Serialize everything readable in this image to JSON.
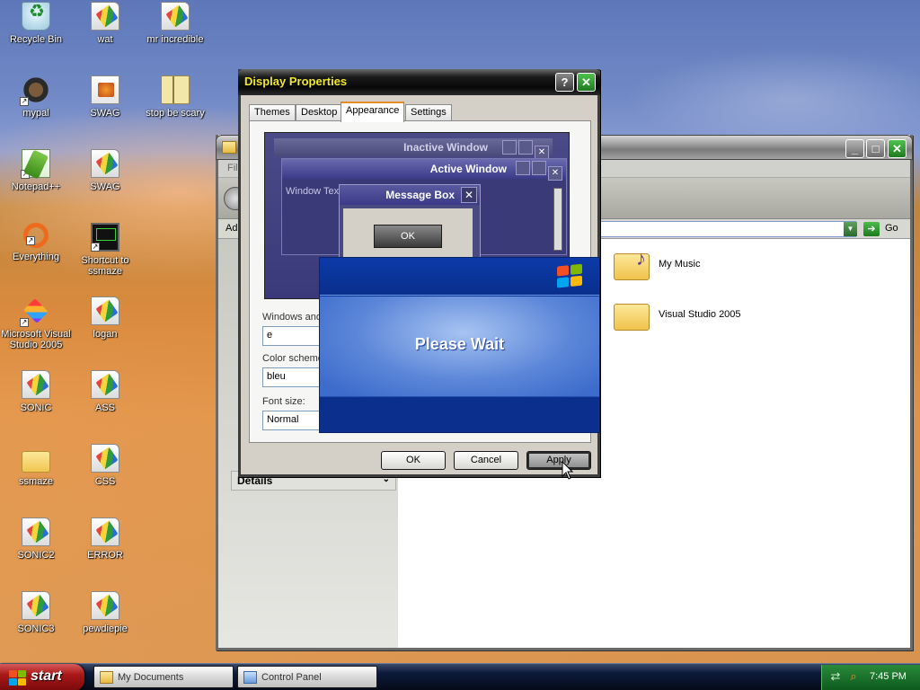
{
  "desktop": {
    "icons": [
      {
        "label": "Recycle Bin"
      },
      {
        "label": "wat"
      },
      {
        "label": "mr incredible"
      },
      {
        "label": "mypal"
      },
      {
        "label": "SWAG"
      },
      {
        "label": "stop be scary"
      },
      {
        "label": "Notepad++"
      },
      {
        "label": "SWAG"
      },
      {
        "label": "Everything"
      },
      {
        "label": "Shortcut to ssmaze"
      },
      {
        "label": "Microsoft Visual Studio 2005"
      },
      {
        "label": "logan"
      },
      {
        "label": "SONIC"
      },
      {
        "label": "ASS"
      },
      {
        "label": "ssmaze"
      },
      {
        "label": "CSS"
      },
      {
        "label": "SONIC2"
      },
      {
        "label": "ERROR"
      },
      {
        "label": "SONIC3"
      },
      {
        "label": "pewdiepie"
      }
    ]
  },
  "explorer": {
    "address_label": "Add",
    "go_label": "Go",
    "details_label": "Details",
    "menu_partial": "Fil",
    "files": [
      {
        "label": "My Music"
      },
      {
        "label": "Visual Studio 2005"
      }
    ]
  },
  "dialog": {
    "title": "Display Properties",
    "help_label": "?",
    "close_label": "✕",
    "tabs": [
      {
        "label": "Themes"
      },
      {
        "label": "Desktop"
      },
      {
        "label": "Appearance",
        "active": true
      },
      {
        "label": "Settings"
      }
    ],
    "preview": {
      "inactive_window": "Inactive Window",
      "active_window": "Active Window",
      "window_text": "Window Text",
      "message_box": "Message Box",
      "ok_label": "OK"
    },
    "windows_and_buttons_label": "Windows and",
    "windows_and_buttons_value": "e",
    "color_scheme_label": "Color scheme:",
    "color_scheme_value": "bleu",
    "font_size_label": "Font size:",
    "font_size_value": "Normal",
    "buttons": {
      "ok": "OK",
      "cancel": "Cancel",
      "apply": "Apply"
    }
  },
  "please_wait": {
    "message": "Please Wait"
  },
  "taskbar": {
    "start_label": "start",
    "tasks": [
      {
        "label": "My Documents"
      },
      {
        "label": "Control Panel"
      }
    ],
    "clock": "7:45 PM"
  },
  "colors": {
    "dialog_title": "#f2e92e",
    "start_button": "#a81818",
    "tray": "#1e7a2e",
    "please_wait_blue": "#0a3296"
  }
}
